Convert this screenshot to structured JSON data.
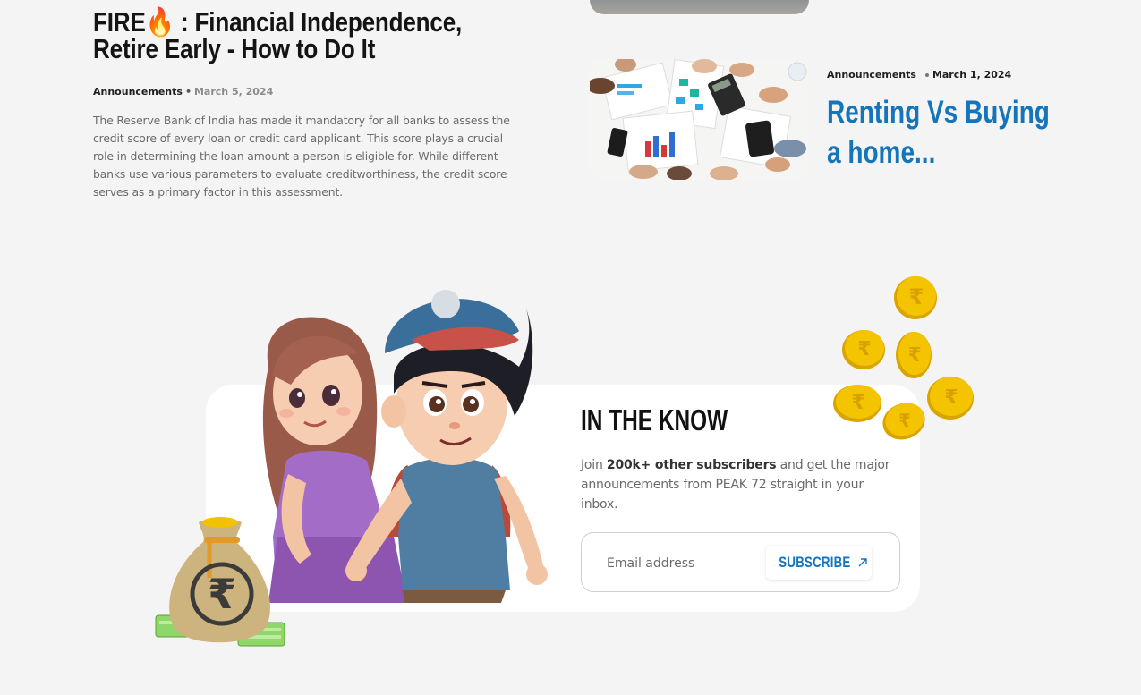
{
  "featured_post": {
    "title_part1": "FIRE",
    "title_emoji": "🔥",
    "title_part2": " : Financial Independence, Retire Early - How to Do It",
    "category": "Announcements",
    "separator": "•",
    "date": "March 5, 2024",
    "excerpt": "The Reserve Bank of India has made it mandatory for all banks to assess the credit score of every loan or credit card applicant. This score plays a crucial role in determining the loan amount a person is eligible for. While different banks use various parameters to evaluate creditworthiness, the credit score serves as a primary factor in this assessment."
  },
  "side_post": {
    "category": "Announcements",
    "date": "March 1, 2024",
    "title": "Renting Vs Buying a home..."
  },
  "newsletter": {
    "heading": "IN THE KNOW",
    "text_before": "Join ",
    "text_bold": "200k+ other subscribers",
    "text_after": " and get the major announcements from PEAK 72 straight in your inbox.",
    "email_placeholder": "Email address",
    "subscribe_label": "SUBSCRIBE",
    "rupee_symbol": "₹"
  },
  "colors": {
    "accent_blue": "#1575bb",
    "coin_gold": "#f2c200",
    "background": "#f4f4f4"
  },
  "icons": [
    "fire-emoji-icon",
    "arrow-up-right-icon",
    "rupee-coin-icon",
    "money-bag-icon"
  ]
}
